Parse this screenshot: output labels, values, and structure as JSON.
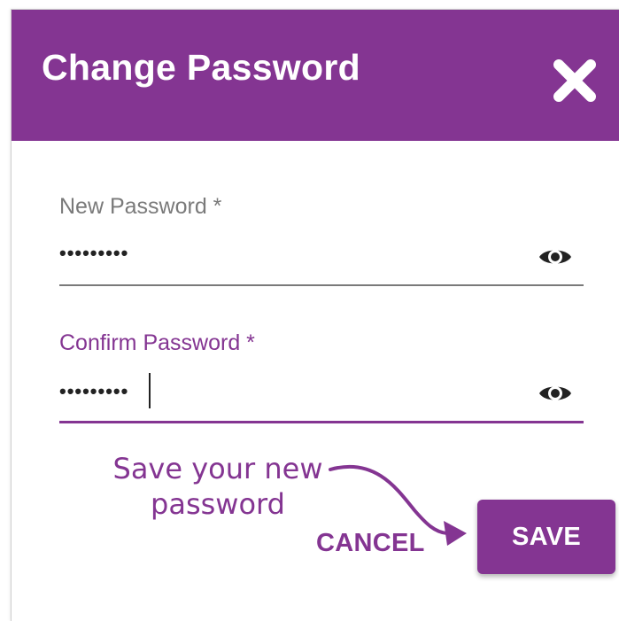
{
  "dialog": {
    "title": "Change Password",
    "close_icon": "close-icon",
    "accent_color": "#843592"
  },
  "fields": {
    "new_password": {
      "label": "New Password *",
      "value": "•••••••••",
      "icon": "eye-icon"
    },
    "confirm_password": {
      "label": "Confirm Password *",
      "value": "•••••••••",
      "icon": "eye-icon"
    }
  },
  "annotation": {
    "line1": "Save your new",
    "line2": "password"
  },
  "actions": {
    "cancel_label": "CANCEL",
    "save_label": "SAVE"
  }
}
